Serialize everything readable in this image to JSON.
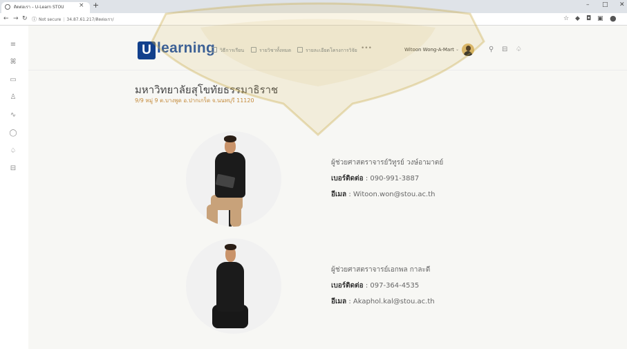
{
  "browser": {
    "tab_title": "ติดต่อเรา – U-Learn STOU",
    "new_tab_label": "+",
    "url_secure_label": "Not secure",
    "url": "34.87.61.217/ติดต่อเรา/",
    "window_controls": [
      "–",
      "□",
      "✕"
    ],
    "toolbar_icons": [
      "star-icon",
      "extension-icon",
      "camera-icon",
      "puzzle-icon",
      "profile-icon"
    ]
  },
  "rail": {
    "icons": [
      "menu-icon",
      "users-icon",
      "monitor-icon",
      "user-icon",
      "activity-icon",
      "chat-icon",
      "bell-icon",
      "lock-icon"
    ]
  },
  "header": {
    "logo_letter": "U",
    "logo_text": "learning",
    "menu": [
      {
        "label": "วิธีการเรียน"
      },
      {
        "label": "รายวิชาทั้งหมด"
      },
      {
        "label": "รายละเอียดโครงการวิจัย"
      }
    ],
    "more": "•••",
    "user_name": "Witoon Wong-A-Mart",
    "user_caret": "⌄",
    "icons": [
      "search-icon",
      "lock-icon",
      "bell-icon"
    ]
  },
  "main": {
    "university_name": "มหาวิทยาลัยสุโขทัยธรรมาธิราช",
    "address": "9/9 หมู่ 9 ต.บางพูด อ.ปากเกร็ด จ.นนทบุรี 11120",
    "contacts": [
      {
        "name": "ผู้ช่วยศาสตราจารย์วิทูรย์ วงษ์อามาตย์",
        "phone_label": "เบอร์ติดต่อ",
        "phone": "090-991-3887",
        "email_label": "อีเมล",
        "email": "Witoon.won@stou.ac.th"
      },
      {
        "name": "ผู้ช่วยศาสตราจารย์เอกพล กาละดี",
        "phone_label": "เบอร์ติดต่อ",
        "phone": "097-364-4535",
        "email_label": "อีเมล",
        "email": "Akaphol.kal@stou.ac.th"
      }
    ]
  },
  "colors": {
    "brand": "#1e4fa0",
    "background": "#f7f7f4",
    "address": "#c48a3a",
    "watermark": "#d8b860"
  }
}
